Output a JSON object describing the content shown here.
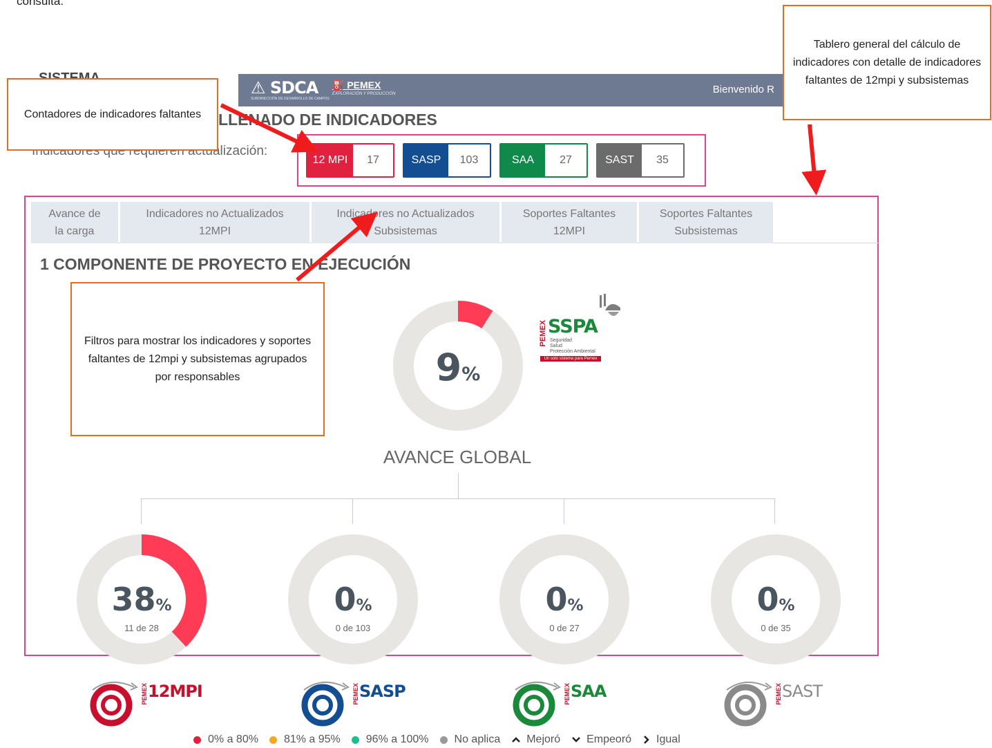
{
  "caption": "consulta.",
  "header": {
    "logo_sdca": "SDCA",
    "logo_sdca_sub": "SUBDIRECCIÓN DE DESARROLLO DE CAMPOS",
    "logo_pemex": "PEMEX",
    "logo_pemex_sub": "EXPLORACIÓN Y PRODUCCIÓN",
    "welcome": "Bienvenido R",
    "clipped_left": "SISTEMA"
  },
  "page_title": "LLENADO DE INDICADORES",
  "subtitle": "Indicadores que requieren actualización:",
  "counters": [
    {
      "label": "12 MPI",
      "count": "17",
      "color": "#e0213f"
    },
    {
      "label": "SASP",
      "count": "103",
      "color": "#134e93"
    },
    {
      "label": "SAA",
      "count": "27",
      "color": "#0f8a4a"
    },
    {
      "label": "SAST",
      "count": "35",
      "color": "#6b6b6b"
    }
  ],
  "tabs": [
    {
      "line1": "Avance de",
      "line2": "la carga",
      "active": true
    },
    {
      "line1": "Indicadores no Actualizados",
      "line2": "12MPI",
      "active": false
    },
    {
      "line1": "Indicadores no Actualizados",
      "line2": "Subsistemas",
      "active": false
    },
    {
      "line1": "Soportes Faltantes",
      "line2": "12MPI",
      "active": false
    },
    {
      "line1": "Soportes Faltantes",
      "line2": "Subsistemas",
      "active": false
    }
  ],
  "section_title": "1 COMPONENTE DE PROYECTO EN EJECUCIÓN",
  "global": {
    "percent": "9",
    "percent_sign": "%",
    "fraction": 0.09,
    "label": "AVANCE GLOBAL"
  },
  "sspa_logo": {
    "text": "SSPA",
    "pemex": "PEMEX",
    "line1": "Seguridad",
    "line2": "Salud",
    "line3": "Protección Ambiental",
    "tagline": "Un solo sistema para Pemex"
  },
  "subsystems": [
    {
      "percent": "38",
      "fraction": 0.38,
      "count": "11 de 28"
    },
    {
      "percent": "0",
      "fraction": 0,
      "count": "0 de 103"
    },
    {
      "percent": "0",
      "fraction": 0,
      "count": "0 de 27"
    },
    {
      "percent": "0",
      "fraction": 0,
      "count": "0 de 35"
    }
  ],
  "percent_sign": "%",
  "bottom_logos": [
    {
      "name": "12MPI",
      "color": "#c8102e"
    },
    {
      "name": "SASP",
      "color": "#134e93"
    },
    {
      "name": "SAA",
      "color": "#1a8a3a"
    },
    {
      "name": "SAST",
      "color": "#8a8a8a"
    }
  ],
  "legend": [
    {
      "label": "0% a 80%",
      "color": "#e0213f",
      "icon": "dot"
    },
    {
      "label": "81% a 95%",
      "color": "#f5a623",
      "icon": "dot"
    },
    {
      "label": "96% a 100%",
      "color": "#1bbf8f",
      "icon": "dot"
    },
    {
      "label": "No aplica",
      "color": "#9a9a9a",
      "icon": "dot"
    },
    {
      "label": "Mejoró",
      "icon": "chevron-up-icon",
      "glyph": "⌃"
    },
    {
      "label": "Empeoró",
      "icon": "chevron-down-icon",
      "glyph": "⌄"
    },
    {
      "label": "Igual",
      "icon": "chevron-right-icon",
      "glyph": "›"
    }
  ],
  "annotations": {
    "counters_note": "Contadores de indicadores faltantes",
    "filters_note": "Filtros para mostrar los indicadores y soportes faltantes de 12mpi y subsistemas agrupados por responsables",
    "dashboard_note": "Tablero general del cálculo de indicadores con detalle de indicadores faltantes de 12mpi y subsistemas"
  },
  "colors": {
    "accent": "#ff3b55",
    "track": "#e8e6e3",
    "annotation_border": "#e86c1f",
    "frame": "#e0408f",
    "arrow": "#ee1c1c"
  }
}
